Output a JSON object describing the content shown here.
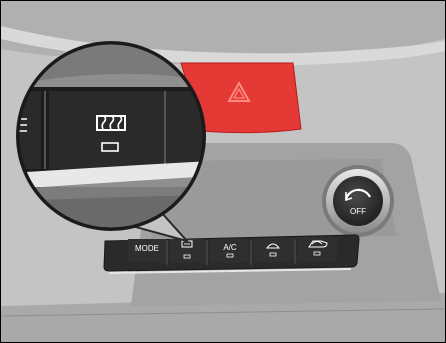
{
  "controls": {
    "mode_label": "MODE",
    "ac_label": "A/C",
    "off_label": "OFF"
  },
  "icons": {
    "hazard": "warning-triangle-icon",
    "rear_defrost": "rear-defroster-icon",
    "front_defrost": "front-defroster-icon",
    "recirculation": "air-recirculation-icon",
    "knob_arrow": "curved-arrow-icon",
    "menu": "three-lines-icon"
  },
  "colors": {
    "dashboard_light": "#c9c9c9",
    "dashboard_mid": "#9a9a9a",
    "dashboard_dark": "#5a5a5a",
    "panel_black": "#1c1c1c",
    "hazard_red": "#e53935",
    "highlight_red": "#ff8a80"
  }
}
